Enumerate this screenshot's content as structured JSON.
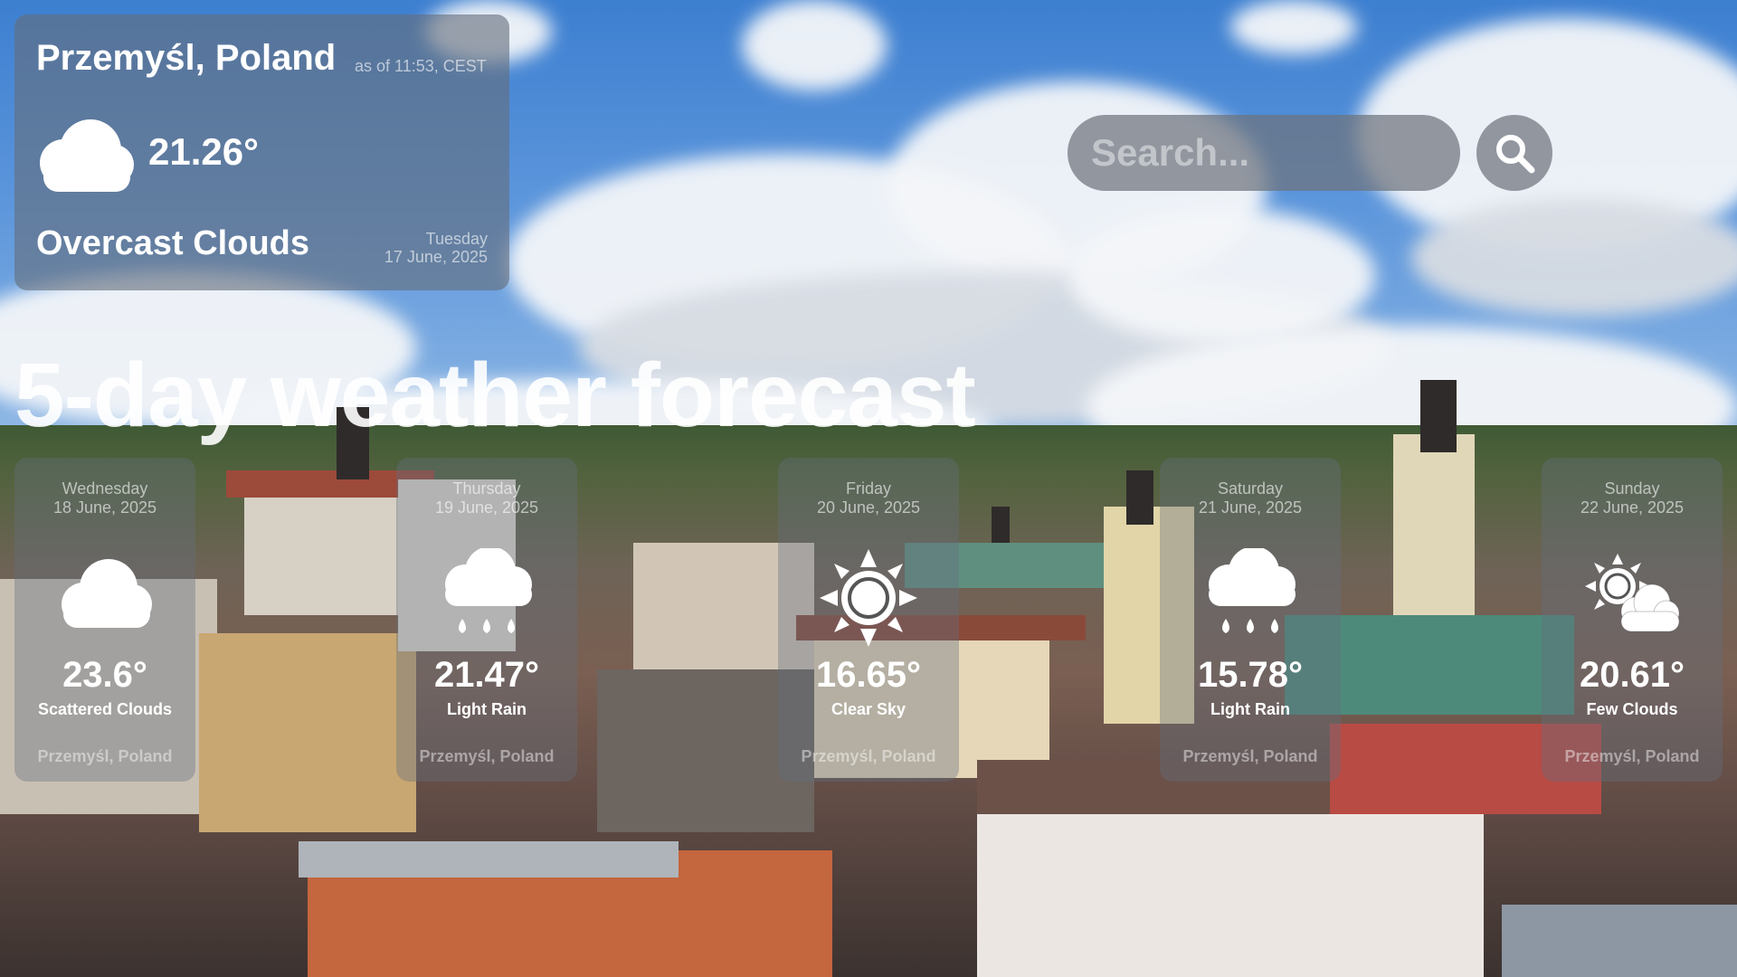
{
  "current": {
    "city": "Przemyśl, Poland",
    "as_of": "as of 11:53, CEST",
    "icon": "cloud-icon",
    "temperature": "21.26°",
    "description": "Overcast Clouds",
    "weekday": "Tuesday",
    "date": "17 June, 2025"
  },
  "search": {
    "placeholder": "Search...",
    "icon": "search-icon"
  },
  "heading": "5-day weather forecast",
  "forecast": [
    {
      "weekday": "Wednesday",
      "date": "18 June, 2025",
      "icon": "cloud-icon",
      "temperature": "23.6°",
      "description": "Scattered Clouds",
      "location": "Przemyśl, Poland"
    },
    {
      "weekday": "Thursday",
      "date": "19 June, 2025",
      "icon": "rain-icon",
      "temperature": "21.47°",
      "description": "Light Rain",
      "location": "Przemyśl, Poland"
    },
    {
      "weekday": "Friday",
      "date": "20 June, 2025",
      "icon": "sun-icon",
      "temperature": "16.65°",
      "description": "Clear Sky",
      "location": "Przemyśl, Poland"
    },
    {
      "weekday": "Saturday",
      "date": "21 June, 2025",
      "icon": "rain-icon",
      "temperature": "15.78°",
      "description": "Light Rain",
      "location": "Przemyśl, Poland"
    },
    {
      "weekday": "Sunday",
      "date": "22 June, 2025",
      "icon": "sun-cloud-icon",
      "temperature": "20.61°",
      "description": "Few Clouds",
      "location": "Przemyśl, Poland"
    }
  ]
}
